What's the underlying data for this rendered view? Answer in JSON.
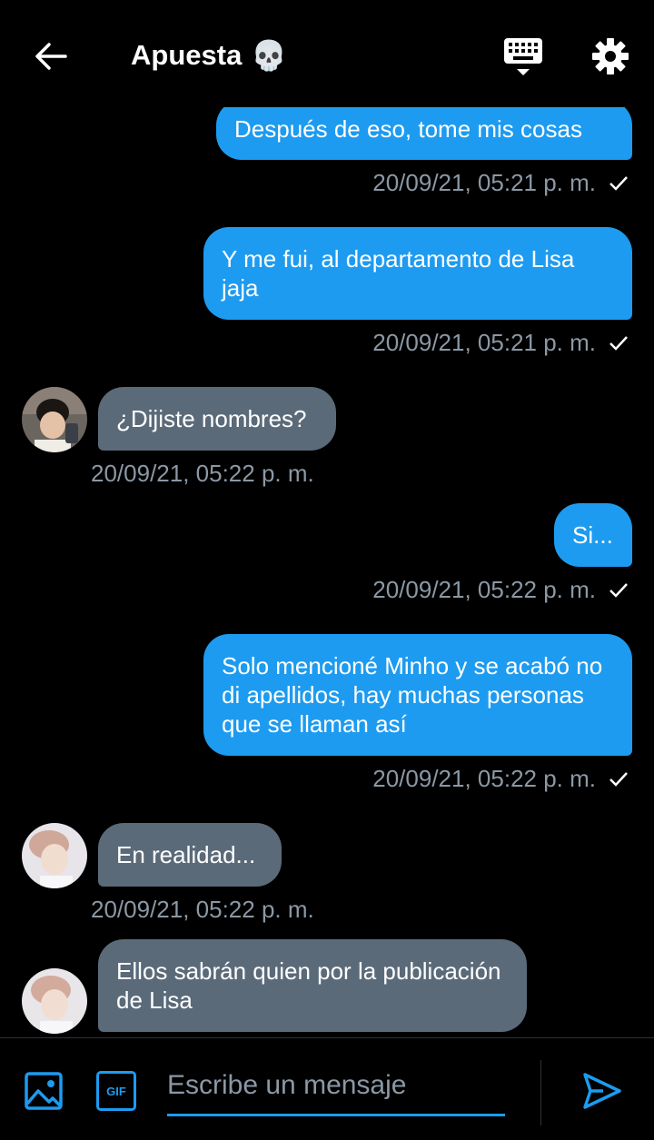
{
  "header": {
    "title": "Apuesta",
    "title_emoji": "💀",
    "icons": {
      "back": "back-arrow-icon",
      "keyboard": "keyboard-icon",
      "settings": "gear-icon"
    }
  },
  "messages": [
    {
      "dir": "out",
      "text": "Después de eso, tome mis cosas",
      "time": "20/09/21, 05:21 p. m.",
      "read": true
    },
    {
      "dir": "out",
      "text": "Y me fui, al departamento de Lisa jaja",
      "time": "20/09/21, 05:21 p. m.",
      "read": true
    },
    {
      "dir": "in",
      "text": "¿Dijiste nombres?",
      "time": "20/09/21, 05:22 p. m."
    },
    {
      "dir": "out",
      "text": "Si...",
      "time": "20/09/21, 05:22 p. m.",
      "read": true
    },
    {
      "dir": "out",
      "text": "Solo mencioné Minho y se acabó no di apellidos, hay muchas personas que se llaman así",
      "time": "20/09/21, 05:22 p. m.",
      "read": true
    },
    {
      "dir": "in",
      "text": "En realidad...",
      "time": "20/09/21, 05:22 p. m."
    },
    {
      "dir": "in",
      "text": "Ellos sabrán quien por la publicación de Lisa"
    }
  ],
  "composer": {
    "placeholder": "Escribe un mensaje",
    "gif_label": "GIF",
    "icons": {
      "image": "image-icon",
      "gif": "gif-icon",
      "send": "send-icon"
    }
  },
  "colors": {
    "accent": "#1d9bf0",
    "incoming_bubble": "#5b6a79",
    "timestamp": "#8b98a5",
    "background": "#000000"
  }
}
